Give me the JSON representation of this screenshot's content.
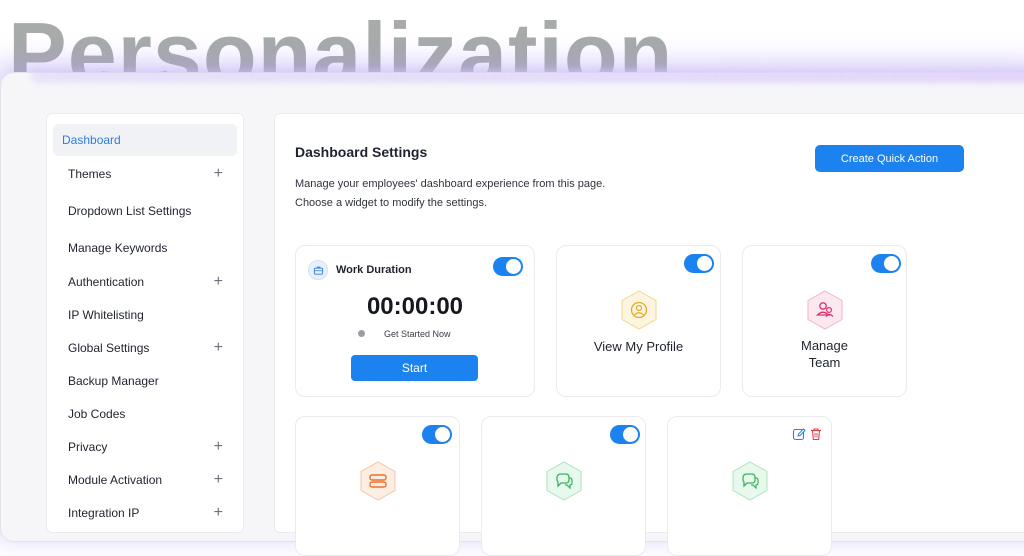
{
  "hero": {
    "title": "Personalization"
  },
  "sidebar": {
    "items": [
      {
        "label": "Dashboard",
        "active": true,
        "expandable": false
      },
      {
        "label": "Themes",
        "expandable": true
      },
      {
        "label": "Dropdown List Settings",
        "expandable": false
      },
      {
        "label": "Manage Keywords",
        "expandable": false
      },
      {
        "label": "Authentication",
        "expandable": true
      },
      {
        "label": "IP Whitelisting",
        "expandable": false
      },
      {
        "label": "Global Settings",
        "expandable": true
      },
      {
        "label": "Backup Manager",
        "expandable": false
      },
      {
        "label": "Job Codes",
        "expandable": false
      },
      {
        "label": "Privacy",
        "expandable": true
      },
      {
        "label": "Module Activation",
        "expandable": true
      },
      {
        "label": "Integration IP",
        "expandable": true
      }
    ],
    "expand_glyph": "+"
  },
  "main": {
    "title": "Dashboard Settings",
    "description_line1": "Manage your employees' dashboard experience from this page.",
    "description_line2": "Choose a widget to modify the settings.",
    "create_button": "Create Quick Action"
  },
  "widgets": {
    "work_duration": {
      "title": "Work Duration",
      "timer": "00:00:00",
      "status": "Get Started Now",
      "start_button": "Start",
      "enabled": true,
      "icon": "briefcase-icon"
    },
    "view_profile": {
      "label": "View My Profile",
      "enabled": true,
      "icon": "user-icon",
      "color": "#e8b93a"
    },
    "manage_team": {
      "label_line1": "Manage",
      "label_line2": "Team",
      "enabled": true,
      "icon": "team-icon",
      "color": "#e0407f"
    },
    "widget_4": {
      "enabled": true,
      "icon": "stack-icon",
      "color": "#f07a3a"
    },
    "widget_5": {
      "enabled": true,
      "icon": "chat-icon",
      "color": "#4fc36a"
    },
    "widget_6": {
      "icon": "chat-icon",
      "color": "#4fc36a",
      "edit_icon": "edit-icon",
      "delete_icon": "trash-icon"
    }
  },
  "colors": {
    "accent": "#1b82f0",
    "hero_text": "#a7aba9"
  }
}
